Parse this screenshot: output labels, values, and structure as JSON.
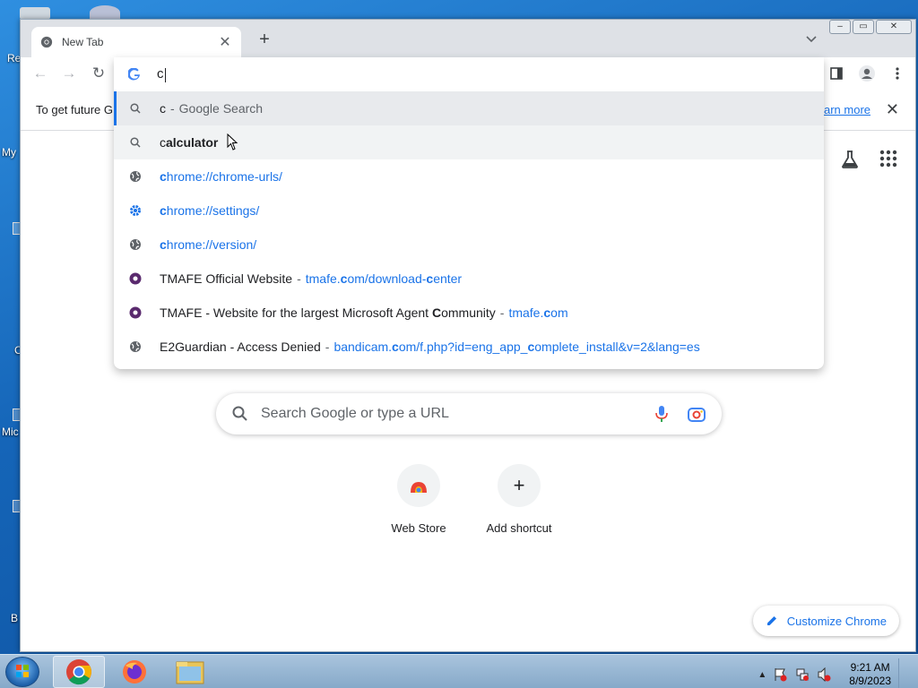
{
  "browser": {
    "tab_title": "New Tab",
    "tab_close": "✕",
    "new_tab": "+",
    "tab_search": "⌄",
    "window_controls": [
      "–",
      "▭",
      "✕"
    ]
  },
  "omnibox": {
    "typed": "c",
    "suggestions": [
      {
        "icon": "search-icon",
        "match": "c",
        "rest": "",
        "dash": " - ",
        "desc": "Google Search",
        "selected": true
      },
      {
        "icon": "search-icon",
        "match": "c",
        "rest": "alculator",
        "bold": true
      },
      {
        "icon": "globe-icon",
        "match": "c",
        "rest": "hrome://chrome-urls/",
        "is_url": true
      },
      {
        "icon": "gear-icon",
        "match": "c",
        "rest": "hrome://settings/",
        "is_url": true
      },
      {
        "icon": "globe-icon",
        "match": "c",
        "rest": "hrome://version/",
        "is_url": true
      },
      {
        "icon": "site-icon",
        "title": "TMAFE Official Website",
        "url_parts": [
          "tmafe.",
          "c",
          "om/download-",
          "c",
          "enter"
        ]
      },
      {
        "icon": "site-icon",
        "title_parts": [
          "TMAFE - Website for the largest Microsoft Agent ",
          "C",
          "ommunity"
        ],
        "url_parts": [
          "tmafe.",
          "c",
          "om"
        ]
      },
      {
        "icon": "globe-icon",
        "title": "E2Guardian - Access Denied",
        "url_parts": [
          "bandicam.",
          "c",
          "om/f.php?id=eng_app_",
          "c",
          "omplete_install&v=2&lang=es"
        ]
      }
    ]
  },
  "infobar": {
    "message": "To get future G",
    "learn_more": "earn more"
  },
  "ntp": {
    "search_placeholder": "Search Google or type a URL",
    "shortcuts": [
      {
        "label": "Web Store"
      },
      {
        "label": "Add shortcut"
      }
    ],
    "customize_label": "Customize Chrome"
  },
  "desktop": {
    "icon_labels": [
      "Re",
      "My",
      "C",
      "Mic",
      "B"
    ]
  },
  "taskbar": {
    "time": "9:21 AM",
    "date": "8/9/2023"
  }
}
